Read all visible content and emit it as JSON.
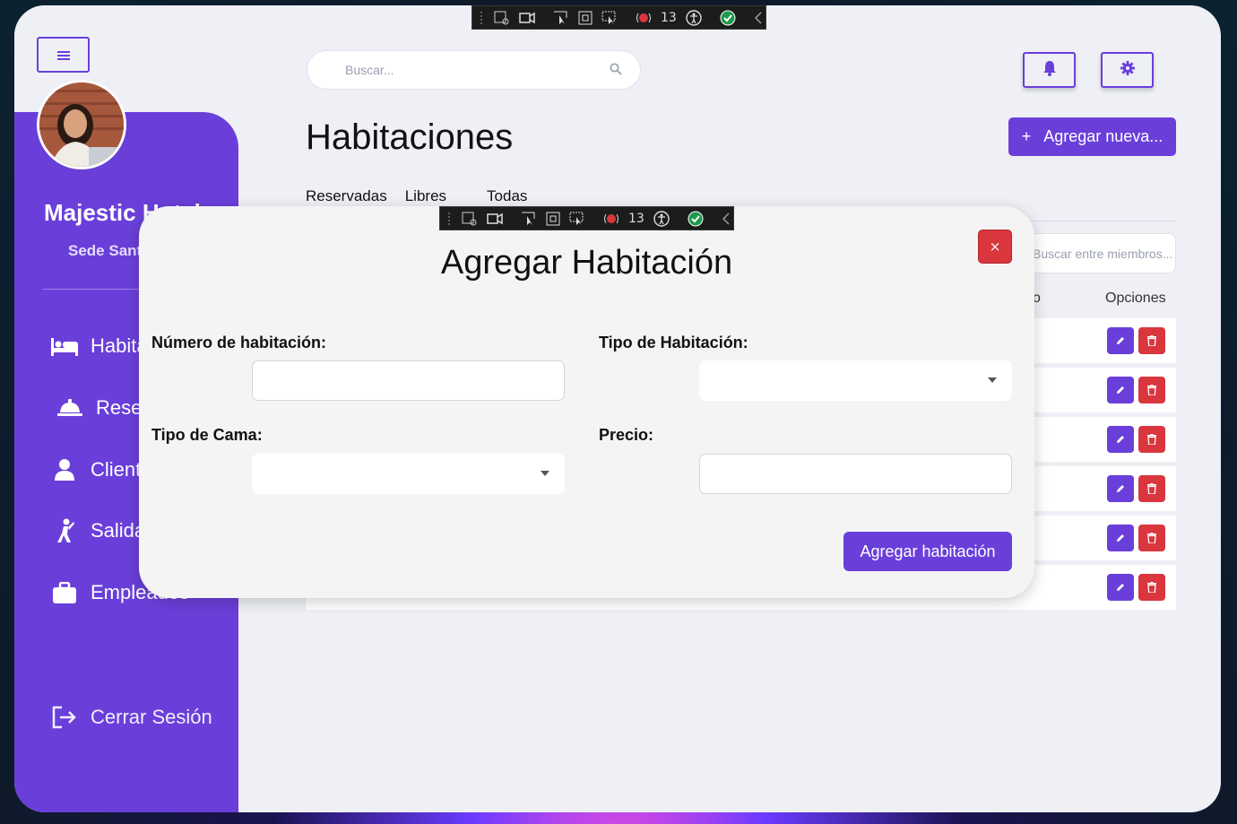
{
  "colors": {
    "accent": "#6a3fd9",
    "danger": "#d9363e",
    "background": "#eef0f6"
  },
  "sidebar": {
    "hotel_name": "Majestic Hotel",
    "sede": "Sede Santa",
    "items": [
      {
        "label": "Habitaciones",
        "icon": "bed-icon"
      },
      {
        "label": "Reservas",
        "icon": "bell-service-icon"
      },
      {
        "label": "Clientes",
        "icon": "person-icon"
      },
      {
        "label": "Salidas",
        "icon": "person-walking-icon"
      },
      {
        "label": "Empleados",
        "icon": "briefcase-icon"
      }
    ],
    "logout_label": "Cerrar Sesión"
  },
  "header": {
    "search_placeholder": "Buscar...",
    "page_title": "Habitaciones",
    "add_new_label": "Agregar nueva...",
    "add_new_icon": "+"
  },
  "tabs": [
    "Reservadas",
    "Libres",
    "Todas"
  ],
  "table": {
    "filter_placeholder": "Buscar entre miembros...",
    "col_estado_fragment": "o",
    "col_opciones": "Opciones",
    "row_count": 6
  },
  "devtools": {
    "badge_count": "13"
  },
  "modal": {
    "title": "Agregar Habitación",
    "close_label": "×",
    "numero_label": "Número de habitación:",
    "tipo_habitacion_label": "Tipo de Habitación:",
    "tipo_cama_label": "Tipo de Cama:",
    "precio_label": "Precio:",
    "submit_label": "Agregar habitación"
  }
}
